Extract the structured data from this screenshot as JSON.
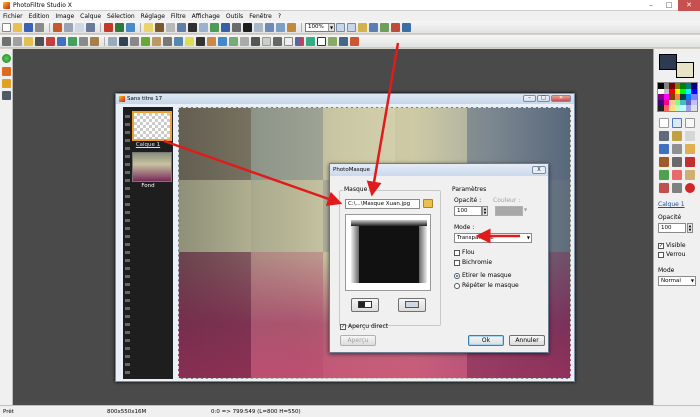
{
  "window": {
    "title": "PhotoFiltre Studio X"
  },
  "menu": [
    "Fichier",
    "Edition",
    "Image",
    "Calque",
    "Sélection",
    "Réglage",
    "Filtre",
    "Affichage",
    "Outils",
    "Fenêtre",
    "?"
  ],
  "toolbar": {
    "zoom_value": "100%"
  },
  "document": {
    "title": "Sans titre 17",
    "layers": [
      {
        "label": "Calque 1"
      },
      {
        "label": "Fond"
      }
    ]
  },
  "dialog": {
    "title": "PhotoMasque",
    "close_label": "X",
    "masque": {
      "group_label": "Masque",
      "file_path": "C:\\...\\Masque Xuan.jpg"
    },
    "parametres": {
      "group_label": "Paramètres",
      "opacite_label": "Opacité :",
      "opacite_value": "100",
      "couleur_label": "Couleur :",
      "mode_label": "Mode :",
      "mode_value": "Transparence",
      "flou_label": "Flou",
      "bichromie_label": "Bichromie",
      "etirer_label": "Etirer le masque",
      "repeter_label": "Répéter le masque"
    },
    "apercu_direct_label": "Aperçu direct",
    "apercu_button": "Aperçu",
    "ok_button": "Ok",
    "annuler_button": "Annuler"
  },
  "right_panel": {
    "layer_name": "Calque 1",
    "opacite_label": "Opacité",
    "opacite_value": "100",
    "visible_label": "Visible",
    "verrou_label": "Verrou",
    "mode_label": "Mode",
    "mode_value": "Normal"
  },
  "status": {
    "state": "Prêt",
    "size": "800x550x16M",
    "coords": "0:0 => 799:549 (L=800  H=550)"
  },
  "colors": {
    "arrow": "#e01b1b",
    "workspace": "#4a4a4a"
  }
}
